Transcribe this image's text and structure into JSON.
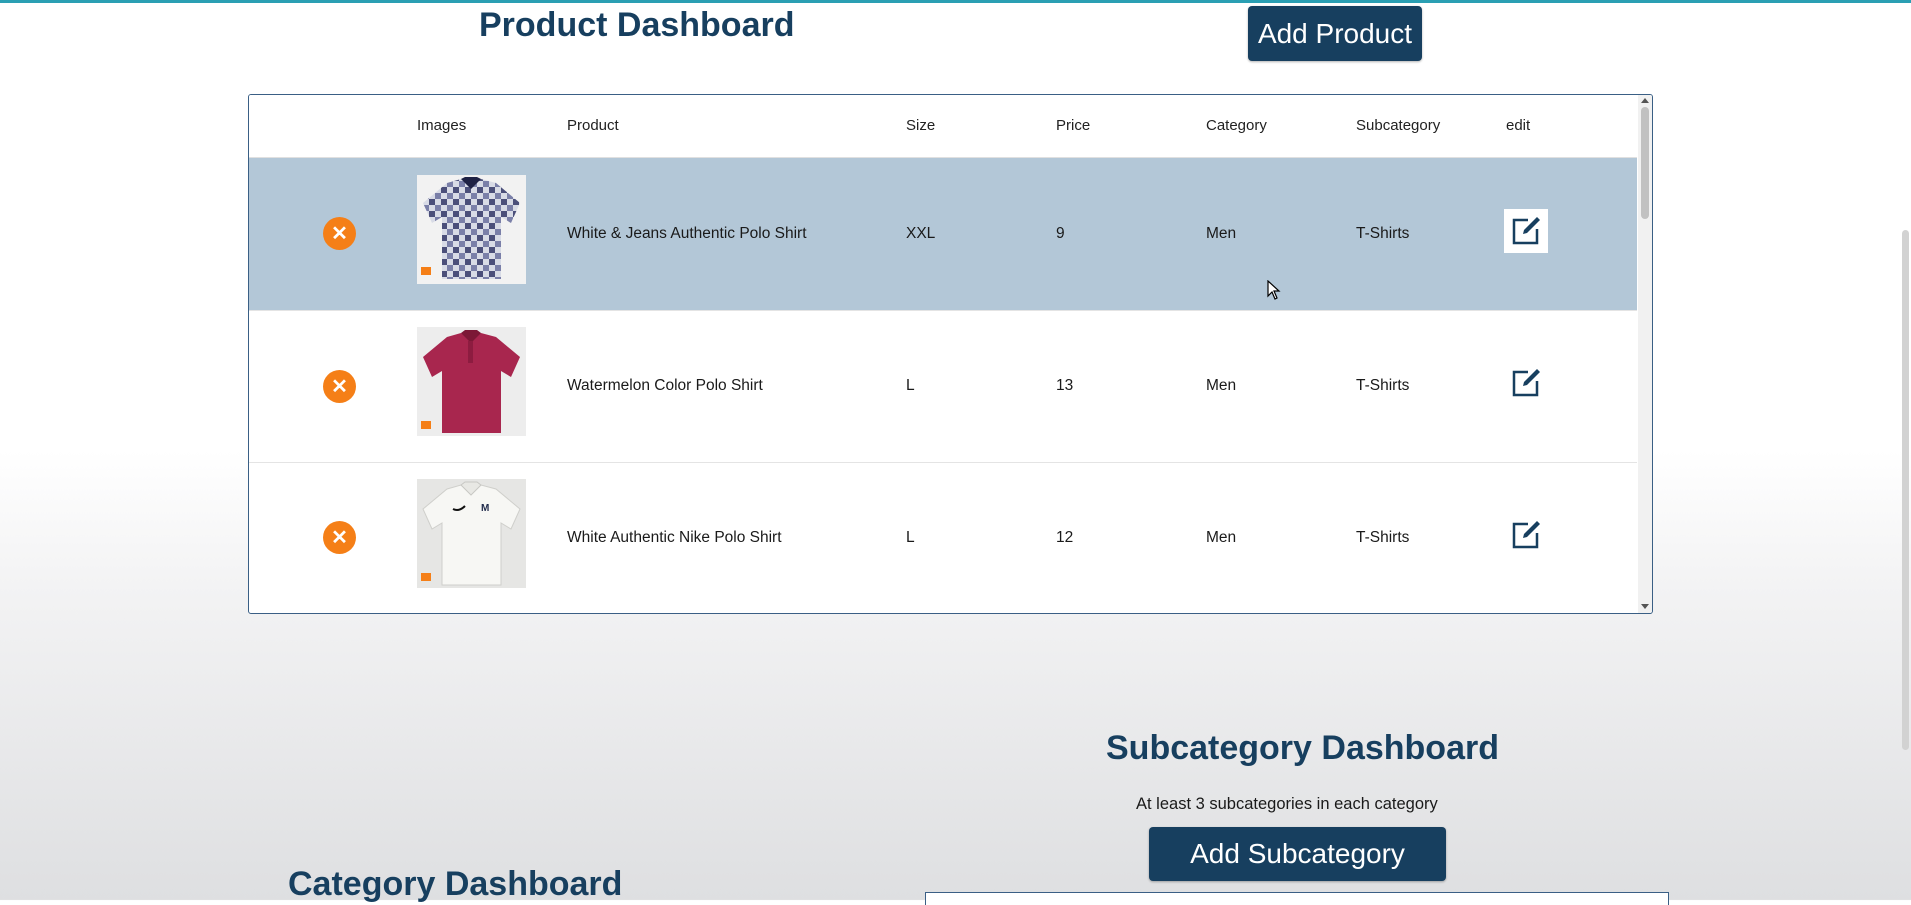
{
  "product_dashboard": {
    "title": "Product Dashboard",
    "add_button": "Add Product",
    "columns": [
      "Images",
      "Product",
      "Size",
      "Price",
      "Category",
      "Subcategory",
      "edit"
    ],
    "rows": [
      {
        "product": "White & Jeans Authentic Polo Shirt",
        "size": "XXL",
        "price": "9",
        "category": "Men",
        "subcategory": "T-Shirts",
        "image": "patterned-polo-shirt-image",
        "delete_icon": "close-icon",
        "edit_icon": "edit-icon"
      },
      {
        "product": "Watermelon Color Polo Shirt",
        "size": "L",
        "price": "13",
        "category": "Men",
        "subcategory": "T-Shirts",
        "image": "red-polo-shirt-image",
        "delete_icon": "close-icon",
        "edit_icon": "edit-icon"
      },
      {
        "product": "White Authentic Nike Polo Shirt",
        "size": "L",
        "price": "12",
        "category": "Men",
        "subcategory": "T-Shirts",
        "image": "white-polo-shirt-image",
        "delete_icon": "close-icon",
        "edit_icon": "edit-icon"
      }
    ]
  },
  "subcategory_dashboard": {
    "title": "Subcategory Dashboard",
    "note": "At least 3 subcategories in each category",
    "add_button": "Add Subcategory"
  },
  "category_dashboard": {
    "title": "Category Dashboard"
  },
  "colors": {
    "primary": "#173f5f",
    "delete": "#f57f17",
    "row_highlight": "#b3c7d7",
    "top_accent": "#2a9fb3"
  }
}
